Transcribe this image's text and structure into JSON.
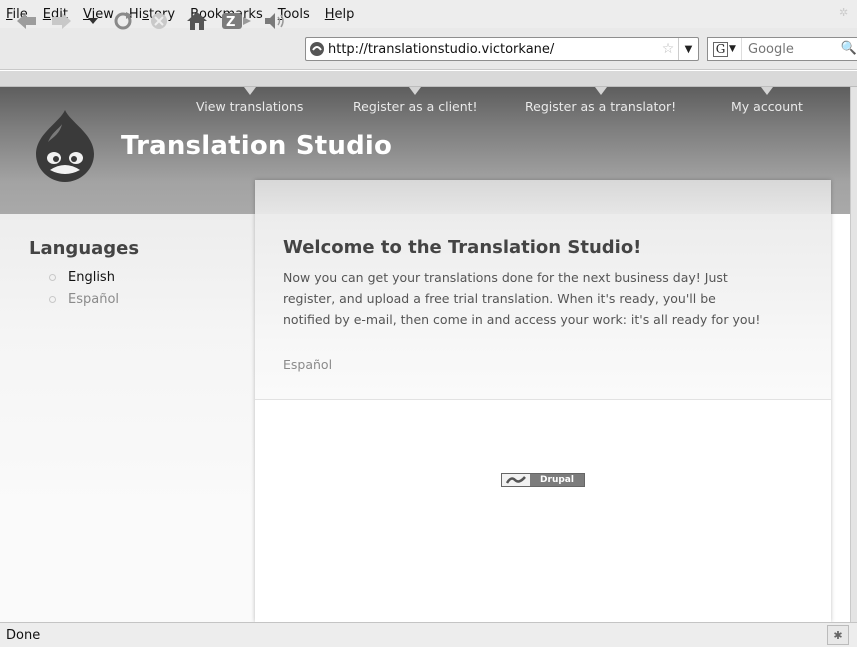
{
  "browser": {
    "menu": [
      "File",
      "Edit",
      "View",
      "History",
      "Bookmarks",
      "Tools",
      "Help"
    ],
    "menu_access_keys": [
      "F",
      "E",
      "V",
      "s",
      "B",
      "T",
      "H"
    ],
    "url": "http://translationstudio.victorkane/",
    "search_placeholder": "Google",
    "status": "Done",
    "toolbar_icons": [
      "back-icon",
      "forward-icon",
      "history-dropdown-icon",
      "reload-icon",
      "stop-icon",
      "home-icon",
      "zotero-icon",
      "speaker-icon"
    ]
  },
  "site": {
    "name": "Translation Studio",
    "primary_links": [
      "View translations",
      "Register as a client!",
      "Register as a translator!",
      "My account"
    ]
  },
  "sidebar": {
    "block_title": "Languages",
    "languages": [
      {
        "label": "English",
        "active": true
      },
      {
        "label": "Español",
        "active": false
      }
    ]
  },
  "content": {
    "title": "Welcome to the Translation Studio!",
    "body_lines": [
      "Now you can get your translations done for the next business day! Just",
      "register, and upload a free trial translation. When it's ready, you'll be",
      "notified by e-mail, then come in and access your work: it's all ready for you!"
    ],
    "language_link": "Español"
  },
  "footer": {
    "powered_by": "Drupal"
  },
  "colors": {
    "header_top": "#5e5e5e",
    "header_bottom": "#a9a9a9",
    "link_gray": "#8a8a8a",
    "text": "#555555"
  }
}
